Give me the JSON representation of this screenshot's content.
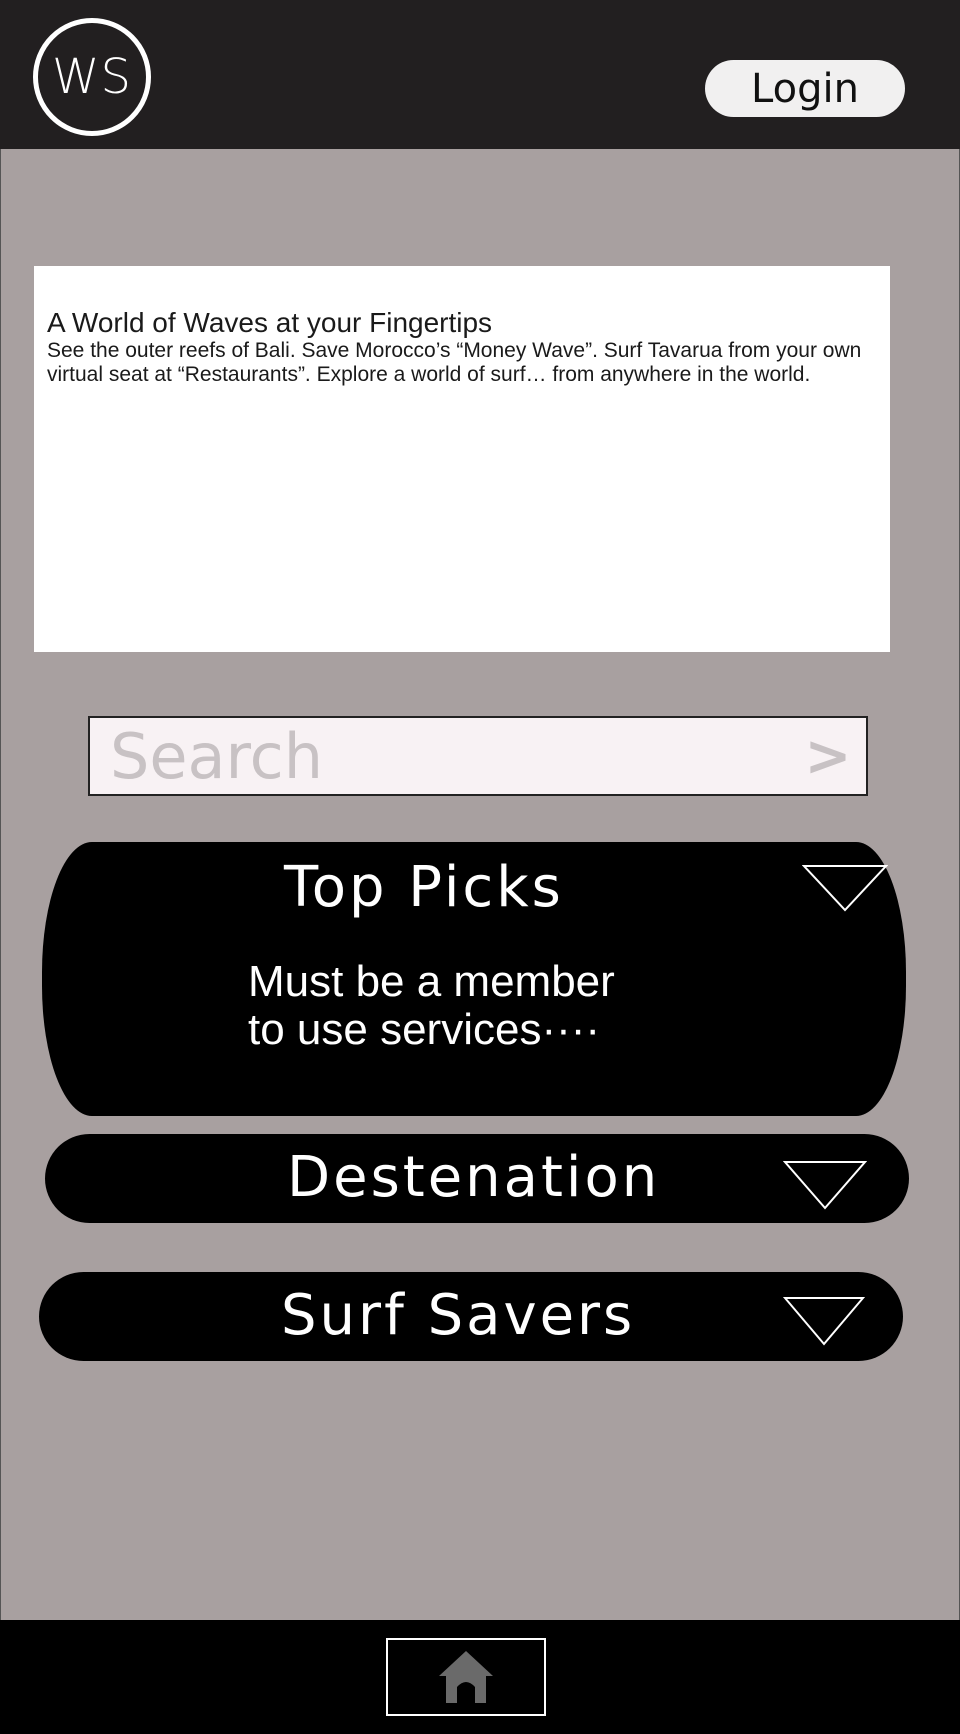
{
  "header": {
    "logo_text": "WS",
    "login_label": "Login"
  },
  "hero": {
    "title": "A World of Waves at your Fingertips",
    "body": "See the outer reefs of Bali. Save Morocco’s “Money Wave”. Surf Tavarua from your own virtual seat at “Restaurants”. Explore a world of surf… from anywhere in the world."
  },
  "search": {
    "placeholder": "Search",
    "go_symbol": ">"
  },
  "panels": {
    "top_picks": {
      "title": "Top Picks",
      "message_line1": "Must be a member",
      "message_line2": "to use services····"
    },
    "destination": {
      "title": "Destenation"
    },
    "surf_savers": {
      "title": "Surf Savers"
    }
  },
  "footer": {
    "home_icon": "home-icon"
  },
  "colors": {
    "header_bg": "#221f20",
    "page_bg": "#a8a0a0",
    "panel_bg": "#000000",
    "search_bg": "#f8f2f4",
    "placeholder": "#c8c2c4"
  }
}
